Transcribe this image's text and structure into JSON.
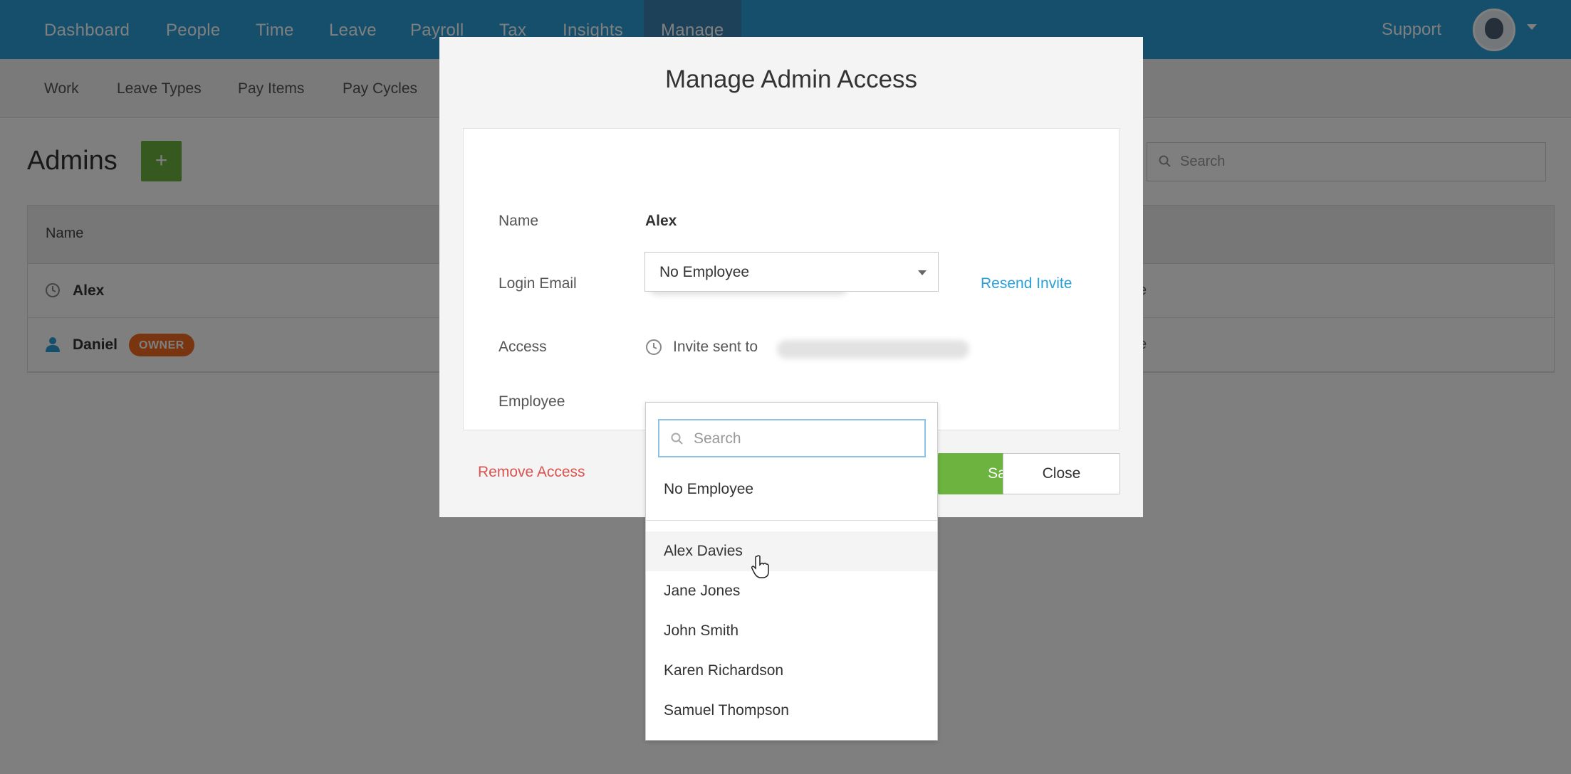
{
  "topnav": {
    "items": [
      "Dashboard",
      "People",
      "Time",
      "Leave",
      "Payroll",
      "Tax",
      "Insights",
      "Manage"
    ],
    "active": "Manage",
    "support_label": "Support"
  },
  "subnav": {
    "items": [
      "Work",
      "Leave Types",
      "Pay Items",
      "Pay Cycles"
    ]
  },
  "page": {
    "title": "Admins",
    "add_label": "+",
    "search_placeholder": "Search"
  },
  "table": {
    "header_name": "Name",
    "rows": [
      {
        "name": "Alex",
        "icon": "clock-icon",
        "tail": "e"
      },
      {
        "name": "Daniel",
        "icon": "person-icon",
        "badge": "OWNER",
        "tail": "e"
      }
    ]
  },
  "modal": {
    "title": "Manage Admin Access",
    "name_label": "Name",
    "name_value": "Alex",
    "email_label": "Login Email",
    "resend_label": "Resend Invite",
    "access_label": "Access",
    "access_value": "Invite sent to",
    "employee_label": "Employee",
    "employee_selected": "No Employee",
    "remove_label": "Remove Access",
    "save_label": "Save",
    "close_label": "Close"
  },
  "dropdown": {
    "search_placeholder": "Search",
    "none_option": "No Employee",
    "options": [
      "Alex Davies",
      "Jane Jones",
      "John Smith",
      "Karen Richardson",
      "Samuel Thompson"
    ],
    "hovered": "Alex Davies"
  },
  "colors": {
    "nav_blue": "#2a9fd8",
    "green": "#6cb33f",
    "owner_orange": "#f26b21",
    "remove_red": "#d9534f"
  }
}
